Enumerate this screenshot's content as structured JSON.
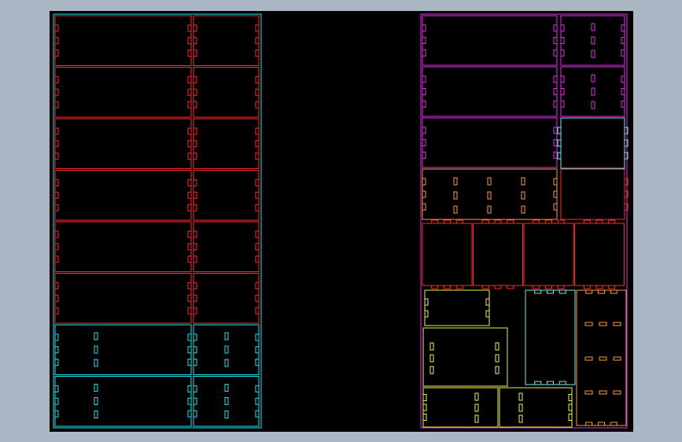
{
  "viewer": {
    "background_color": "#aab6c3",
    "canvas_color": "#000000"
  },
  "layer_colors": {
    "red": "#ff2a2a",
    "cyan": "#19e6f0",
    "magenta": "#e030e8",
    "orange": "#ff9a3a",
    "yellow": "#f2f24a",
    "light_cyan": "#7ee8ea"
  },
  "sheets": {
    "left_sheet_outline": "cyan",
    "right_sheet_outline": "magenta"
  }
}
